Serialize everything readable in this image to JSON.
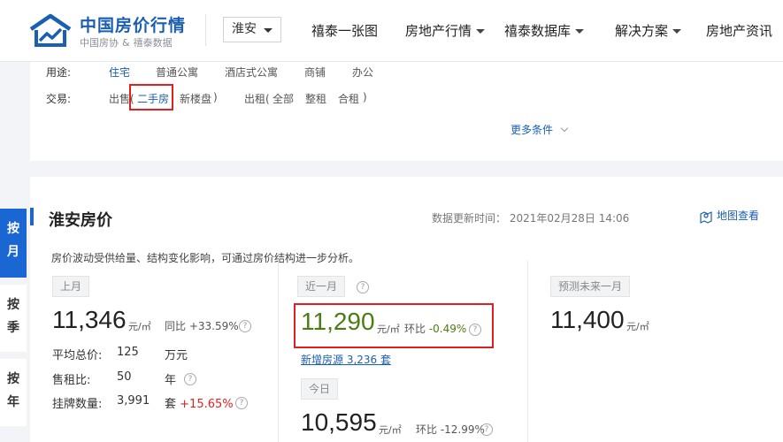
{
  "header": {
    "logo_title": "中国房价行情",
    "logo_sub_left": "中国房协",
    "logo_sub_amp": "&",
    "logo_sub_right": "禧泰数据",
    "city": "淮安",
    "nav": [
      {
        "label": "禧泰一张图"
      },
      {
        "label": "房地产行情"
      },
      {
        "label": "禧泰数据库"
      },
      {
        "label": "解决方案"
      },
      {
        "label": "房地产资讯"
      }
    ]
  },
  "filters": {
    "usage_label": "用途:",
    "usage_options": [
      "住宅",
      "普通公寓",
      "酒店式公寓",
      "商铺",
      "办公"
    ],
    "trade_label": "交易:",
    "sale_prefix": "出售(",
    "sale_options": [
      "二手房",
      "新楼盘"
    ],
    "sale_suffix": ")",
    "rent_prefix": "出租(",
    "rent_options": [
      "全部",
      "整租",
      "合租"
    ],
    "rent_suffix": ")",
    "more": "更多条件"
  },
  "side_tabs": [
    {
      "label": "按月"
    },
    {
      "label": "按季"
    },
    {
      "label": "按年"
    }
  ],
  "main": {
    "title": "淮安房价",
    "update_label": "数据更新时间： 2021年02月28日 14:06",
    "map_link": "地图查看",
    "description": "房价波动受供给量、结构变化影响，可通过房价结构进一步分析。",
    "last_month": {
      "tag": "上月",
      "price": "11,346",
      "unit": "元/㎡",
      "yoy_label": "同比",
      "yoy_value": "+33.59%",
      "rows": [
        {
          "label": "平均总价:",
          "value": "125",
          "unit": "万元"
        },
        {
          "label": "售租比:",
          "value": "50",
          "unit": "年"
        },
        {
          "label": "挂牌数量:",
          "value": "3,991",
          "unit": "套",
          "change": "+15.65%"
        }
      ]
    },
    "recent_month": {
      "tag": "近一月",
      "price": "11,290",
      "unit": "元/㎡",
      "mom_label": "环比",
      "mom_value": "-0.49%",
      "new_listings": "新增房源 3,236 套"
    },
    "today": {
      "tag": "今日",
      "price": "10,595",
      "unit": "元/㎡",
      "mom_label": "环比",
      "mom_value": "-12.99%"
    },
    "forecast": {
      "tag": "预测未来一月",
      "price": "11,400",
      "unit": "元/㎡"
    },
    "help_icon": "?"
  }
}
